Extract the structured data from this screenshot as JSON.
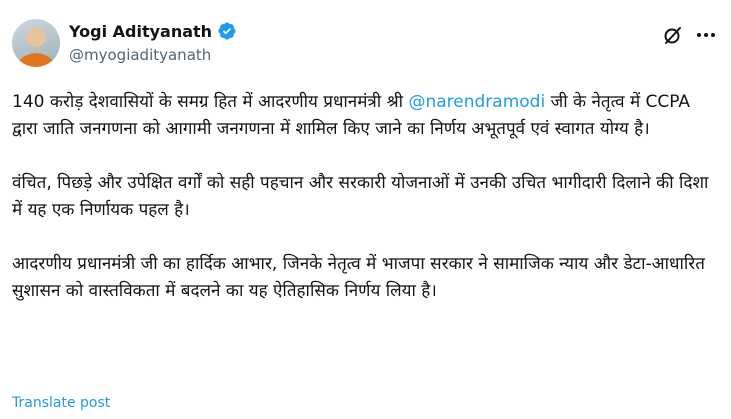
{
  "author": {
    "display_name": "Yogi Adityanath",
    "handle": "@myogiadityanath",
    "verified_color": "#1d9bf0"
  },
  "header_icons": [
    "grok-icon",
    "more-icon"
  ],
  "post": {
    "para1_before": "140 करोड़ देशवासियों के समग्र हित में आदरणीय प्रधानमंत्री श्री ",
    "mention": "@narendramodi",
    "para1_after": " जी के नेतृत्व में CCPA द्वारा जाति जनगणना को आगामी जनगणना में शामिल किए जाने का निर्णय अभूतपूर्व एवं स्वागत योग्य है।",
    "para2": "वंचित, पिछड़े और उपेक्षित वर्गों को सही पहचान और सरकारी योजनाओं में उनकी उचित भागीदारी दिलाने की दिशा में यह एक निर्णायक पहल है।",
    "para3": "आदरणीय प्रधानमंत्री जी का हार्दिक आभार, जिनके नेतृत्व में भाजपा सरकार ने सामाजिक न्याय और डेटा-आधारित सुशासन को वास्तविकता में बदलने का यह ऐतिहासिक निर्णय लिया है।"
  },
  "translate_label": "Translate post",
  "colors": {
    "link": "#1d9bf0",
    "secondary_text": "#536471",
    "primary_text": "#0f1419"
  }
}
